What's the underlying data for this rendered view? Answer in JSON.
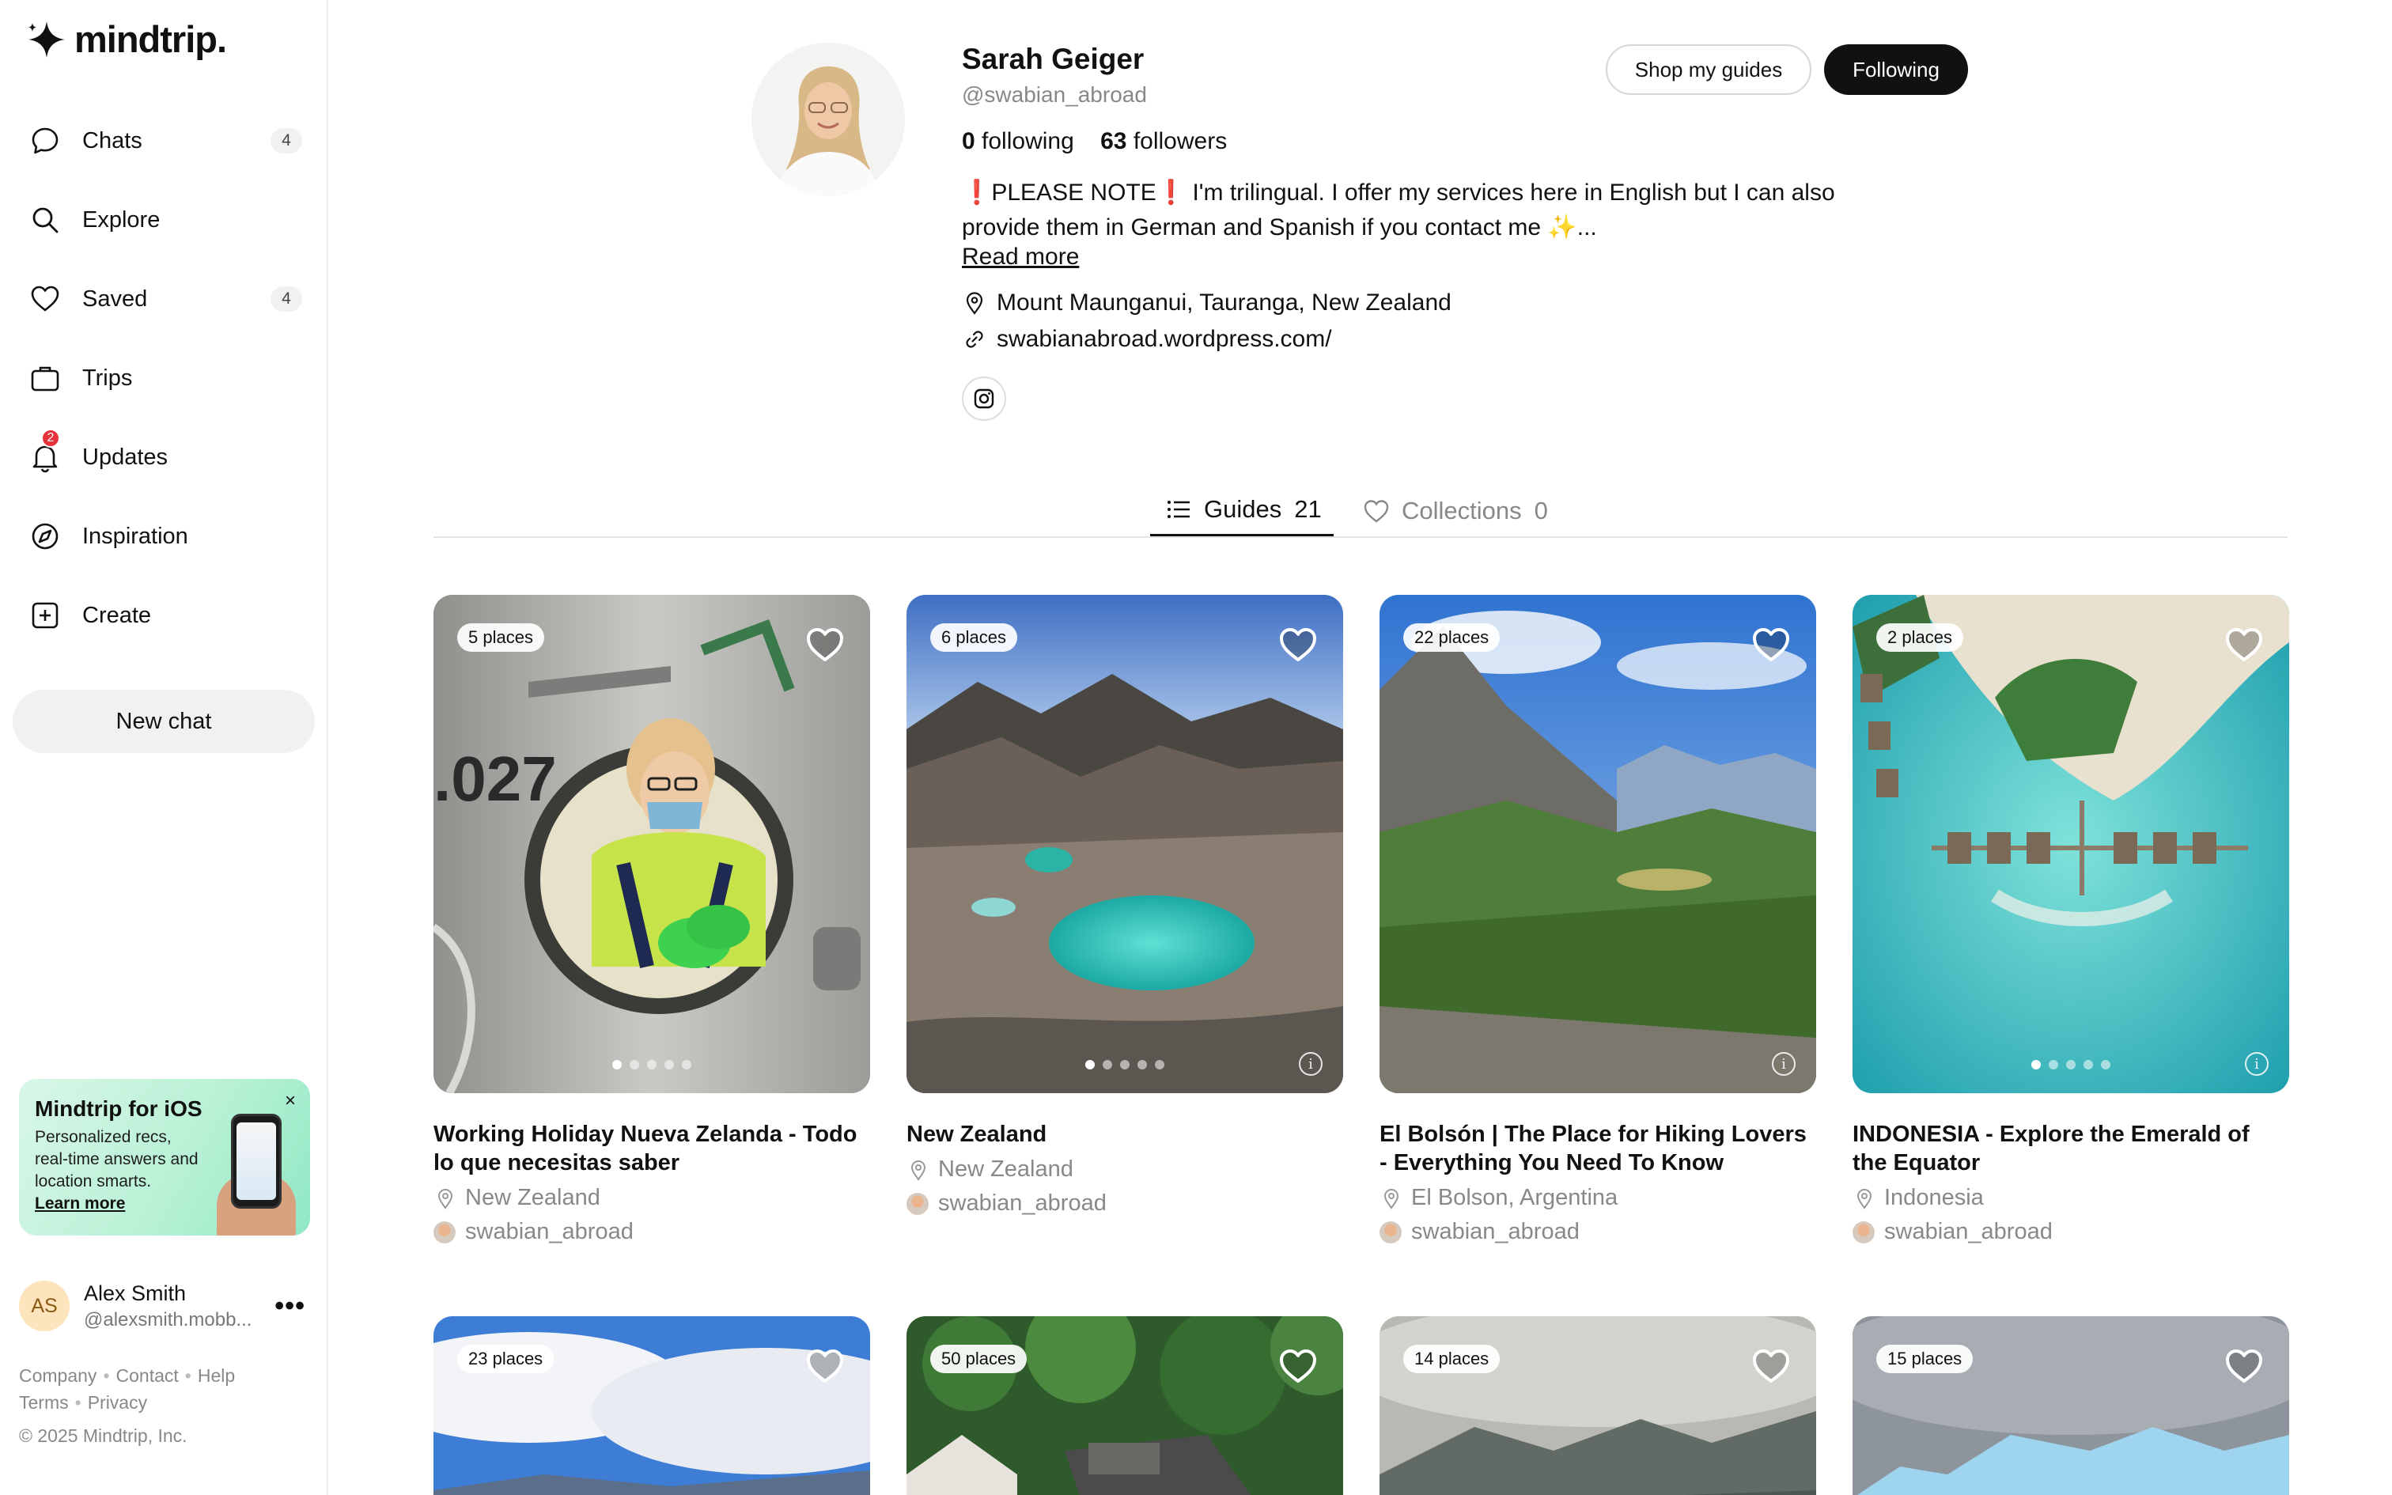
{
  "app": {
    "brand": "mindtrip."
  },
  "sidebar": {
    "nav": [
      {
        "label": "Chats",
        "count": "4",
        "icon": "chat-bubble-icon"
      },
      {
        "label": "Explore",
        "count": "",
        "icon": "search-icon"
      },
      {
        "label": "Saved",
        "count": "4",
        "icon": "heart-icon"
      },
      {
        "label": "Trips",
        "count": "",
        "icon": "suitcase-icon"
      },
      {
        "label": "Updates",
        "count": "",
        "icon": "bell-icon",
        "badge": "2"
      },
      {
        "label": "Inspiration",
        "count": "",
        "icon": "compass-icon"
      },
      {
        "label": "Create",
        "count": "",
        "icon": "plus-square-icon"
      }
    ],
    "new_chat_label": "New chat",
    "promo": {
      "title": "Mindtrip for iOS",
      "body": "Personalized recs, real-time answers and location smarts.",
      "link": "Learn more",
      "close": "×"
    },
    "user": {
      "initials": "AS",
      "name": "Alex Smith",
      "handle": "@alexsmith.mobb...",
      "more": "•••"
    },
    "footer": {
      "links_row1": [
        "Company",
        "Contact",
        "Help"
      ],
      "links_row2": [
        "Terms",
        "Privacy"
      ],
      "copyright": "© 2025 Mindtrip, Inc."
    }
  },
  "profile": {
    "name": "Sarah Geiger",
    "handle": "@swabian_abroad",
    "shop_label": "Shop my guides",
    "following_label": "Following",
    "following_count": "0",
    "following_text": "following",
    "followers_count": "63",
    "followers_text": "followers",
    "bio_line1": "❗PLEASE NOTE❗ I'm trilingual. I offer my services here in English but I can also",
    "bio_line2": "provide them in German and Spanish if you contact me ✨...",
    "read_more": "Read more",
    "location": "Mount Maunganui, Tauranga, New Zealand",
    "website": "swabianabroad.wordpress.com/"
  },
  "tabs": {
    "guides_label": "Guides",
    "guides_count": "21",
    "collections_label": "Collections",
    "collections_count": "0"
  },
  "guides": [
    {
      "places": "5 places",
      "title": "Working Holiday Nueva Zelanda - Todo lo que necesitas saber",
      "location": "New Zealand",
      "author": "swabian_abroad",
      "dots": 5
    },
    {
      "places": "6 places",
      "title": "New Zealand",
      "location": "New Zealand",
      "author": "swabian_abroad",
      "dots": 5
    },
    {
      "places": "22 places",
      "title": "El Bolsón | The Place for Hiking Lovers - Everything You Need To Know",
      "location": "El Bolson, Argentina",
      "author": "swabian_abroad",
      "dots": 0
    },
    {
      "places": "2 places",
      "title": "INDONESIA - Explore the Emerald of the Equator",
      "location": "Indonesia",
      "author": "swabian_abroad",
      "dots": 5
    },
    {
      "places": "23 places"
    },
    {
      "places": "50 places"
    },
    {
      "places": "14 places"
    },
    {
      "places": "15 places"
    }
  ]
}
